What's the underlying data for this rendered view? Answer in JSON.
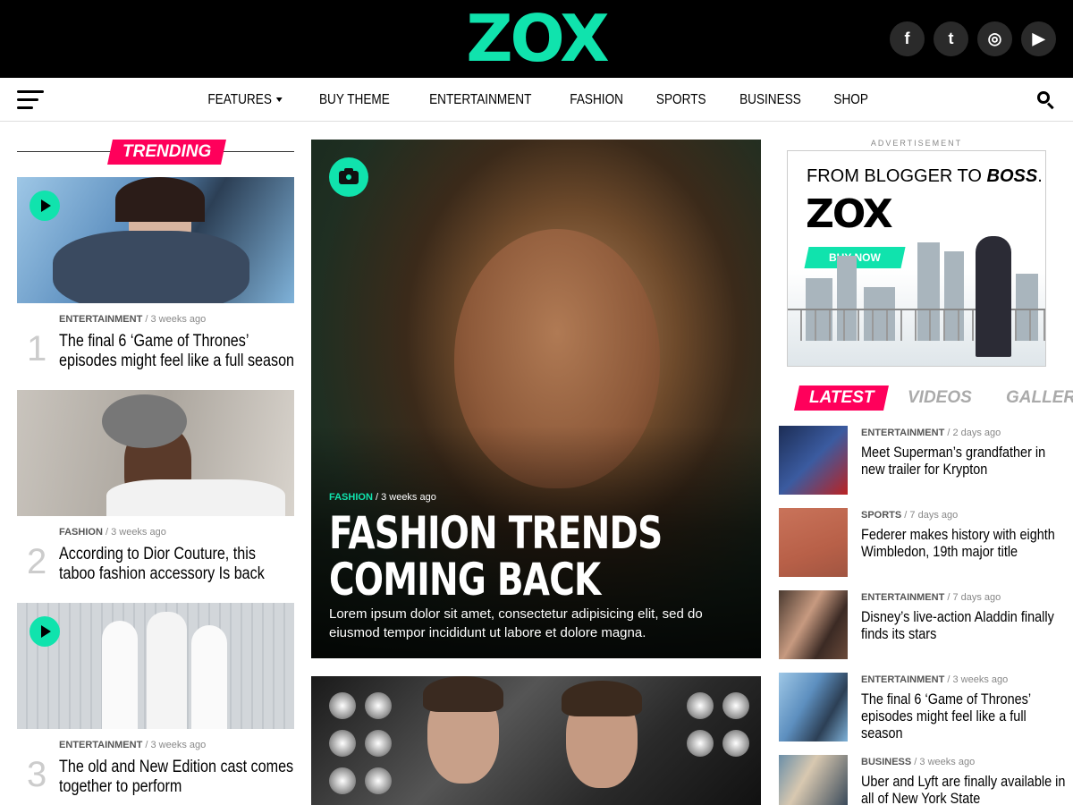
{
  "header": {
    "logo": "ZOX",
    "social": [
      {
        "icon": "facebook-icon",
        "glyph": "f"
      },
      {
        "icon": "twitter-icon",
        "glyph": "t"
      },
      {
        "icon": "instagram-icon",
        "glyph": "◎"
      },
      {
        "icon": "youtube-icon",
        "glyph": "▶"
      }
    ]
  },
  "nav": {
    "items": [
      "FEATURES",
      "BUY THEME",
      "ENTERTAINMENT",
      "FASHION",
      "SPORTS",
      "BUSINESS",
      "SHOP"
    ]
  },
  "trending": {
    "label": "TRENDING",
    "items": [
      {
        "rank": "1",
        "category": "ENTERTAINMENT",
        "time": "3 weeks ago",
        "title": "The final 6 ‘Game of Thrones’ episodes might feel like a full season"
      },
      {
        "rank": "2",
        "category": "FASHION",
        "time": "3 weeks ago",
        "title": "According to Dior Couture, this taboo fashion accessory Is back"
      },
      {
        "rank": "3",
        "category": "ENTERTAINMENT",
        "time": "3 weeks ago",
        "title": "The old and New Edition cast comes together to perform"
      }
    ]
  },
  "feature": {
    "category": "FASHION",
    "time": "3 weeks ago",
    "title": "FASHION TRENDS COMING BACK",
    "description": "Lorem ipsum dolor sit amet, consectetur adipisicing elit, sed do eiusmod tempor incididunt ut labore et dolore magna."
  },
  "ad": {
    "label": "ADVERTISEMENT",
    "tagline_pre": "FROM BLOGGER TO ",
    "tagline_em": "BOSS",
    "tagline_post": ".",
    "logo": "ZOX",
    "button": "BUY NOW"
  },
  "sidebar_tabs": [
    "LATEST",
    "VIDEOS",
    "GALLERIES"
  ],
  "latest": [
    {
      "category": "ENTERTAINMENT",
      "time": "2 days ago",
      "title": "Meet Superman’s grandfather in new trailer for Krypton"
    },
    {
      "category": "SPORTS",
      "time": "7 days ago",
      "title": "Federer makes history with eighth Wimbledon, 19th major title"
    },
    {
      "category": "ENTERTAINMENT",
      "time": "7 days ago",
      "title": "Disney’s live-action Aladdin finally finds its stars"
    },
    {
      "category": "ENTERTAINMENT",
      "time": "3 weeks ago",
      "title": "The final 6 ‘Game of Thrones’ episodes might feel like a full season"
    },
    {
      "category": "BUSINESS",
      "time": "3 weeks ago",
      "title": "Uber and Lyft are finally available in all of New York State"
    }
  ],
  "colors": {
    "accent": "#10e3ad",
    "trending": "#ff005b",
    "header_bg": "#000000"
  }
}
